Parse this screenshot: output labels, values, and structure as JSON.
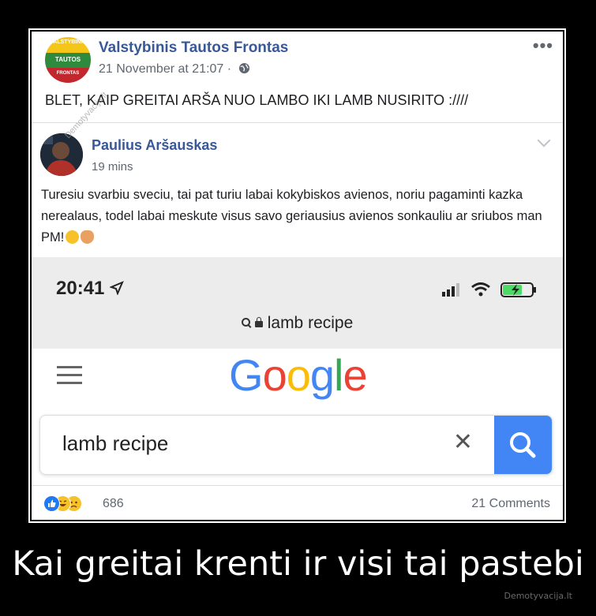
{
  "post": {
    "page_name": "Valstybinis Tautos Frontas",
    "time": "21 November at 21:07 ·",
    "text": "BLET, KAIP GREITAI ARŠA NUO LAMBO IKI LAMB NUSIRITO :////",
    "more_icon": "•••",
    "logo_text_top": "VALSTYBINIS",
    "logo_text_mid": "TAUTOS",
    "logo_text_bottom": "FRONTAS"
  },
  "shared": {
    "user_name": "Paulius Aršauskas",
    "time": "19 mins",
    "text": "Turesiu svarbiu sveciu, tai pat turiu labai kokybiskos avienos, noriu pagaminti kazka nerealaus, todel labai meskute visus savo geriausius avienos sonkauliu ar sriubos man PM!"
  },
  "phone": {
    "status_time": "20:41",
    "address": "lamb recipe",
    "logo_letters": [
      {
        "ch": "G",
        "color": "#4285f4"
      },
      {
        "ch": "o",
        "color": "#ea4335"
      },
      {
        "ch": "o",
        "color": "#fbbc05"
      },
      {
        "ch": "g",
        "color": "#4285f4"
      },
      {
        "ch": "l",
        "color": "#34a853"
      },
      {
        "ch": "e",
        "color": "#ea4335"
      }
    ],
    "search_value": "lamb recipe",
    "clear_icon": "✕"
  },
  "footer": {
    "reaction_count": "686",
    "comments": "21 Comments"
  },
  "caption": "Kai greitai krenti ir visi tai pastebi",
  "site": "Demotyvacija.lt",
  "watermark": "Demotyvacija.lt"
}
